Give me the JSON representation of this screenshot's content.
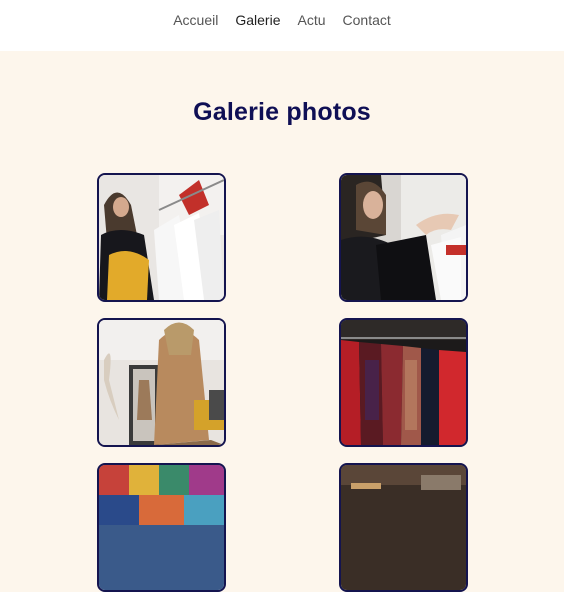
{
  "nav": {
    "items": [
      {
        "label": "Accueil",
        "active": false
      },
      {
        "label": "Galerie",
        "active": true
      },
      {
        "label": "Actu",
        "active": false
      },
      {
        "label": "Contact",
        "active": false
      }
    ]
  },
  "gallery": {
    "title": "Galerie photos",
    "photos": [
      {
        "subject": "woman browsing clothing rack with yellow top"
      },
      {
        "subject": "woman holding hanger with black garment"
      },
      {
        "subject": "woman in camel coat in front of mirror"
      },
      {
        "subject": "clothes rack with red and plaid garments"
      },
      {
        "subject": "colorful patterned fabrics"
      },
      {
        "subject": "shop interior with blurred lights"
      }
    ]
  },
  "colors": {
    "title": "#0f0f55",
    "background": "#fdf6ec",
    "photo_border": "#14144f"
  }
}
